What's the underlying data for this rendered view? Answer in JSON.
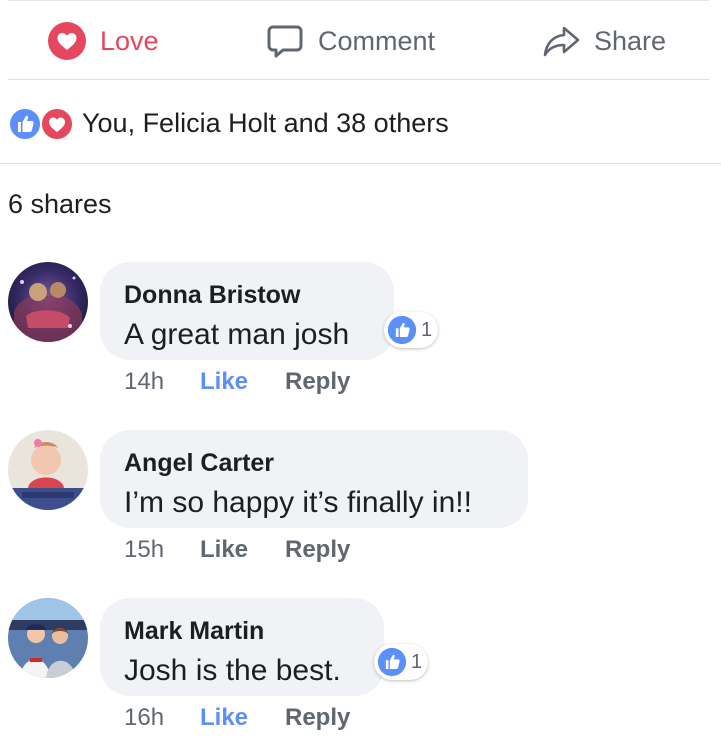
{
  "actions": {
    "love_label": "Love",
    "comment_label": "Comment",
    "share_label": "Share"
  },
  "reactions": {
    "summary": "You, Felicia Holt and 38 others"
  },
  "shares": {
    "label": "6 shares"
  },
  "comments": [
    {
      "author": "Donna Bristow",
      "text": "A great man josh",
      "time": "14h",
      "like_label": "Like",
      "reply_label": "Reply",
      "liked": true,
      "reaction_count": "1"
    },
    {
      "author": "Angel Carter",
      "text": "I’m so happy it’s finally in!!",
      "time": "15h",
      "like_label": "Like",
      "reply_label": "Reply",
      "liked": false,
      "reaction_count": ""
    },
    {
      "author": "Mark Martin",
      "text": "Josh is the best.",
      "time": "16h",
      "like_label": "Like",
      "reply_label": "Reply",
      "liked": true,
      "reaction_count": "1"
    }
  ],
  "colors": {
    "love": "#e5485e",
    "like_blue": "#5b8ff9",
    "secondary_text": "#606770",
    "bubble_bg": "#f0f2f5"
  }
}
